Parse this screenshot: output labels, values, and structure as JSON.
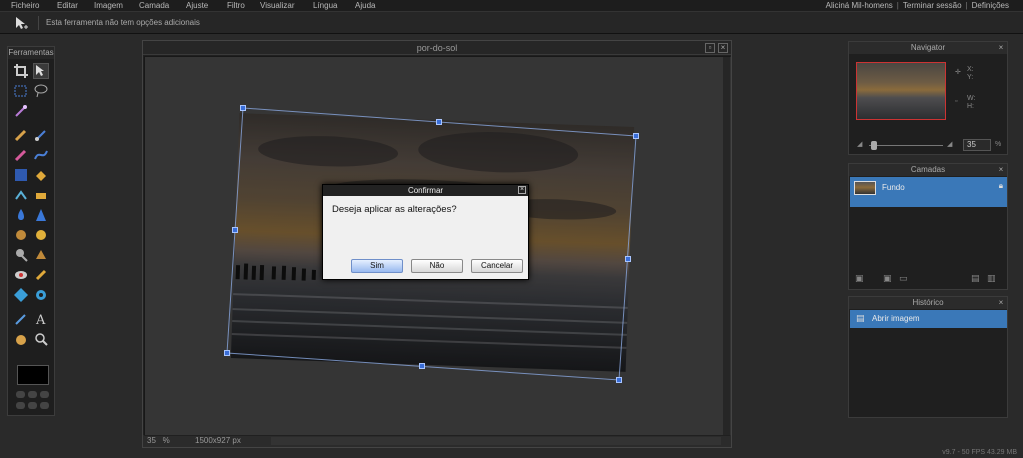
{
  "menu": {
    "items": [
      "Ficheiro",
      "Editar",
      "Imagem",
      "Camada",
      "Ajuste",
      "Filtro",
      "Visualizar",
      "Língua",
      "Ajuda"
    ],
    "right_links": [
      "Aliciná Mil-homens",
      "Terminar sessão",
      "Definições"
    ]
  },
  "options_bar": {
    "text": "Esta ferramenta não tem opções adicionais"
  },
  "tools_panel": {
    "title": "Ferramentas"
  },
  "document": {
    "title": "por-do-sol",
    "zoom": "35",
    "zoom_unit": "%",
    "dimensions": "1500x927 px"
  },
  "dialog": {
    "title": "Confirmar",
    "message": "Deseja aplicar as alterações?",
    "buttons": {
      "yes": "Sim",
      "no": "Não",
      "cancel": "Cancelar"
    }
  },
  "navigator": {
    "title": "Navigator",
    "x_label": "X:",
    "y_label": "Y:",
    "w_label": "W:",
    "h_label": "H:",
    "zoom_value": "35",
    "zoom_unit": "%"
  },
  "layers": {
    "title": "Camadas",
    "items": [
      {
        "name": "Fundo"
      }
    ]
  },
  "history": {
    "title": "Histórico",
    "items": [
      {
        "name": "Abrir imagem"
      }
    ]
  },
  "footer": {
    "text": "v9.7 - 50 FPS 43.29 MB"
  },
  "colors": {
    "accent": "#3a78b8",
    "handle": "#3a6ed8",
    "highlight_frame": "#cc3333"
  }
}
